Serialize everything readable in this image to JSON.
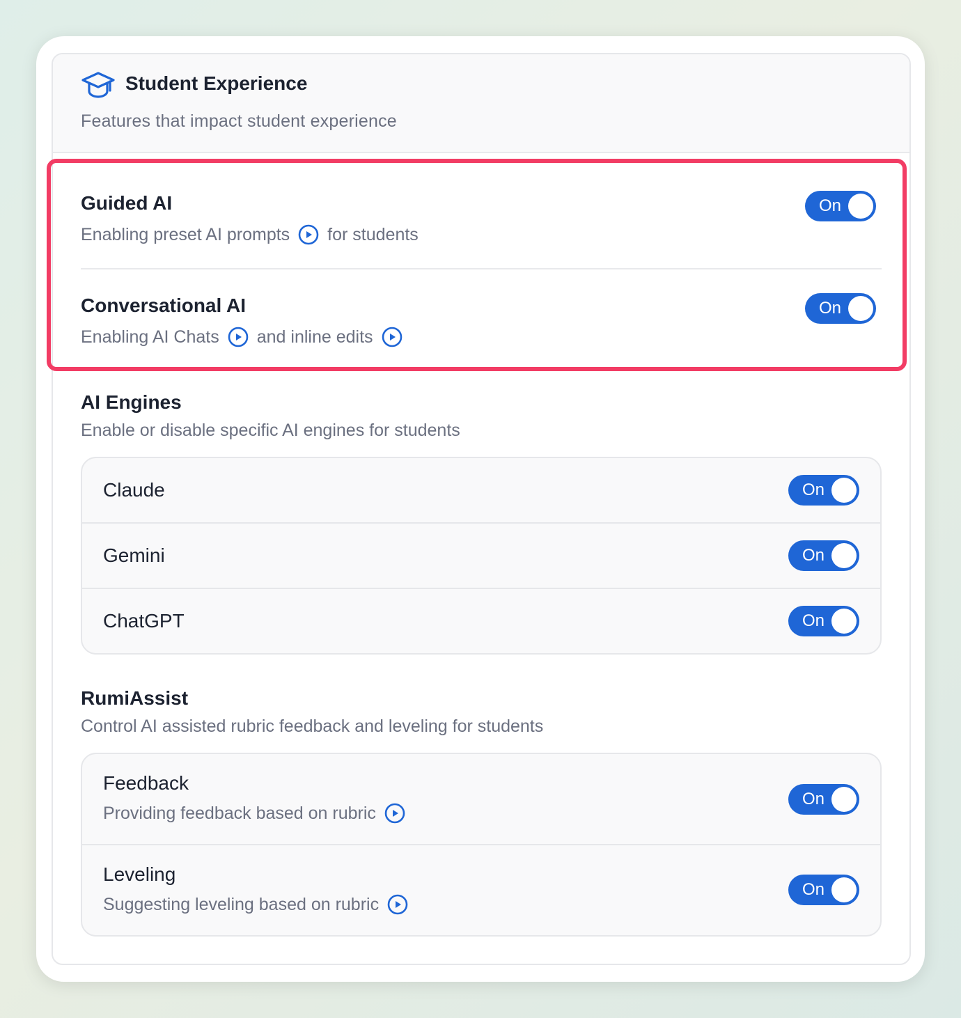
{
  "header": {
    "title": "Student Experience",
    "subtitle": "Features that impact student experience",
    "icon": "graduation-cap-icon"
  },
  "guided_ai": {
    "title": "Guided AI",
    "desc_part1": "Enabling preset AI prompts",
    "desc_part2": "for students",
    "toggle": "On"
  },
  "conversational_ai": {
    "title": "Conversational AI",
    "desc_part1": "Enabling AI Chats",
    "desc_part2": "and inline edits",
    "toggle": "On"
  },
  "ai_engines": {
    "title": "AI Engines",
    "subtitle": "Enable or disable specific AI engines for students",
    "items": [
      {
        "label": "Claude",
        "toggle": "On"
      },
      {
        "label": "Gemini",
        "toggle": "On"
      },
      {
        "label": "ChatGPT",
        "toggle": "On"
      }
    ]
  },
  "rumiassist": {
    "title": "RumiAssist",
    "subtitle": "Control AI assisted rubric feedback and leveling for students",
    "items": [
      {
        "label": "Feedback",
        "desc": "Providing feedback based on rubric",
        "toggle": "On"
      },
      {
        "label": "Leveling",
        "desc": "Suggesting leveling based on rubric",
        "toggle": "On"
      }
    ]
  },
  "colors": {
    "accent": "#1f66d6",
    "highlight": "#f23c64"
  }
}
